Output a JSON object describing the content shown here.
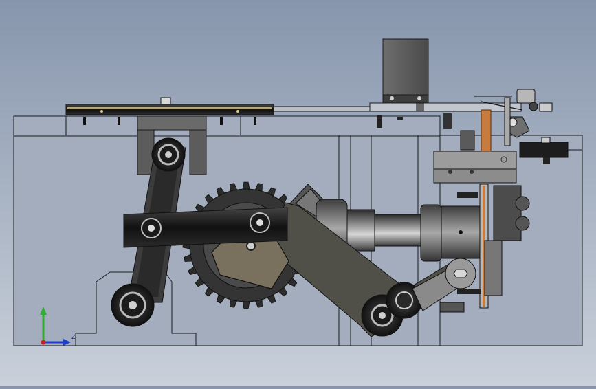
{
  "viewport": {
    "background_top": "#8796ad",
    "background_bottom": "#c9d0da",
    "body_fill": "#a3adbd",
    "dark_part": "#2e2e2e",
    "arm_fill": "#505048",
    "plate_fill": "#7a705e",
    "accent_copper": "#c77b3d",
    "edge_color": "#1b1b1b"
  },
  "triad": {
    "icon": "coordinate-triad-icon",
    "axis_colors": {
      "y": "#2db02d",
      "x": "#1c3ec9",
      "z": "#d02020"
    },
    "label": "Z"
  }
}
